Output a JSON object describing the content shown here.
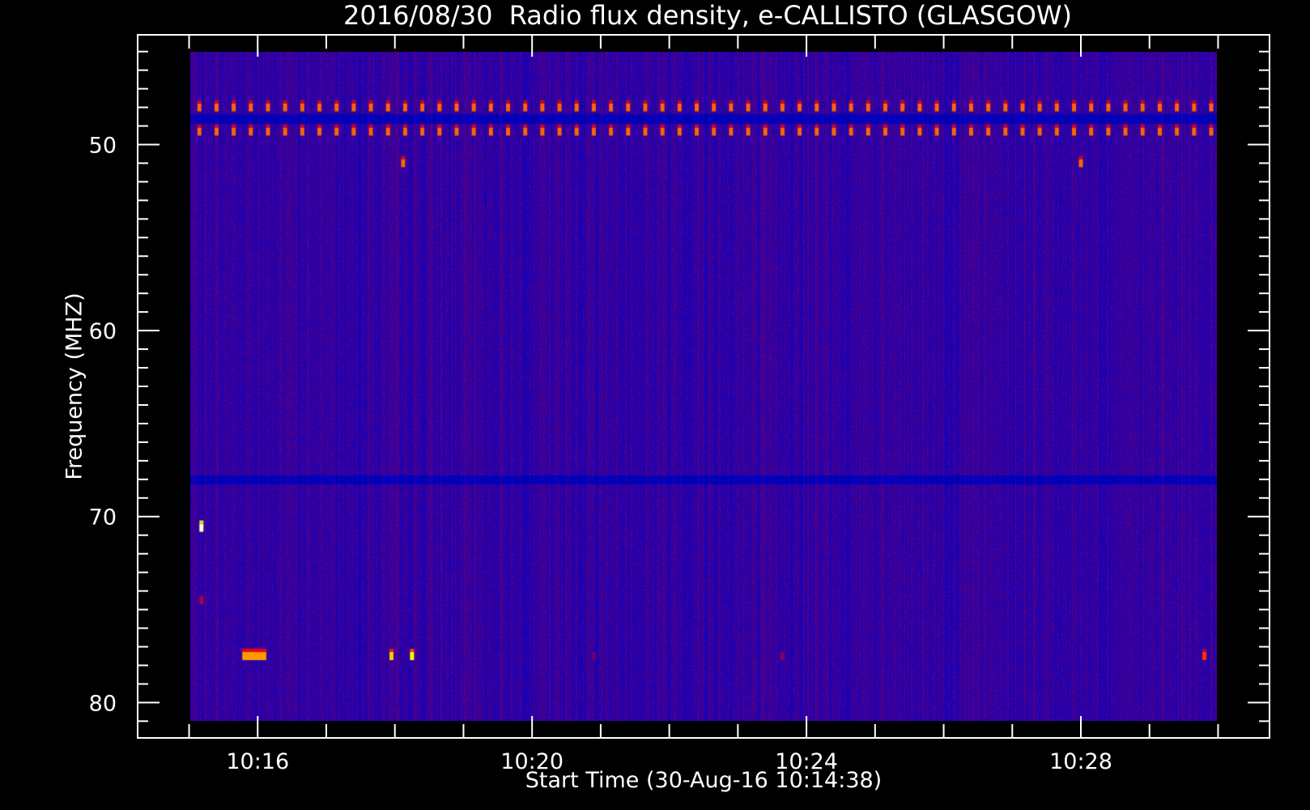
{
  "chart_data": {
    "type": "heatmap",
    "title": "2016/08/30  Radio flux density, e-CALLISTO (GLASGOW)",
    "xlabel": "Start Time (30-Aug-16 10:14:38)",
    "ylabel": "Frequency (MHZ)",
    "x_axis": {
      "unit": "minutes after 10:00",
      "range": [
        14.25,
        30.75
      ],
      "data_range": [
        15,
        30
      ],
      "major_ticks": [
        16,
        20,
        24,
        28
      ],
      "tick_labels": [
        "10:16",
        "10:20",
        "10:24",
        "10:28"
      ],
      "minor_step": 1
    },
    "y_axis": {
      "unit": "MHz",
      "range": [
        44.1,
        81.9
      ],
      "data_range": [
        45,
        81
      ],
      "inverted": true,
      "major_ticks": [
        50,
        60,
        70,
        80
      ],
      "tick_labels": [
        "50",
        "60",
        "70",
        "80"
      ],
      "minor_step": 1
    },
    "colormap": [
      "#000000",
      "#0000c8",
      "#ff0000",
      "#ffff00",
      "#ffffff"
    ],
    "background_level": 0.3,
    "periodic_lines": [
      {
        "freq_mhz": 48.0,
        "period_min": 0.25,
        "start_min": 15.15,
        "level": 0.6
      },
      {
        "freq_mhz": 49.3,
        "period_min": 0.25,
        "start_min": 15.15,
        "level": 0.6
      }
    ],
    "dark_bands_mhz": [
      48.6,
      68.0
    ],
    "spots": [
      {
        "time_min": 18.12,
        "freq_mhz": 51.0,
        "level": 0.6
      },
      {
        "time_min": 28.0,
        "freq_mhz": 51.0,
        "level": 0.6
      },
      {
        "time_min": 15.18,
        "freq_mhz": 70.6,
        "level": 0.95
      },
      {
        "time_min": 15.18,
        "freq_mhz": 74.5,
        "level": 0.42
      },
      {
        "time_min": 15.95,
        "freq_mhz": 77.5,
        "level": 0.65,
        "width_min": 0.35
      },
      {
        "time_min": 17.95,
        "freq_mhz": 77.5,
        "level": 0.7
      },
      {
        "time_min": 18.25,
        "freq_mhz": 77.5,
        "level": 0.75
      },
      {
        "time_min": 29.8,
        "freq_mhz": 77.5,
        "level": 0.55
      },
      {
        "time_min": 23.65,
        "freq_mhz": 77.5,
        "level": 0.38
      },
      {
        "time_min": 20.9,
        "freq_mhz": 77.5,
        "level": 0.36
      }
    ]
  }
}
